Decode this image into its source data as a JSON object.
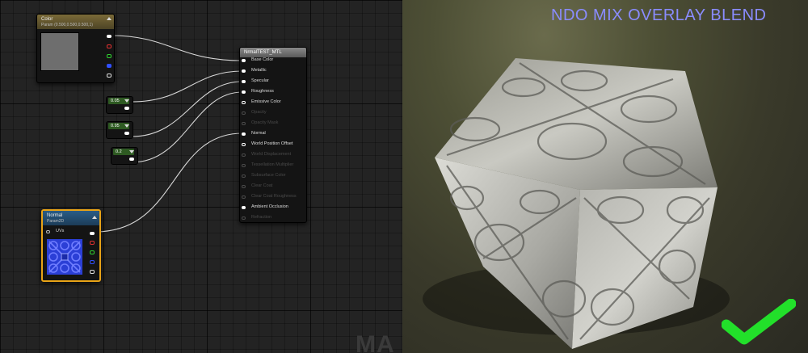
{
  "graph": {
    "color_node": {
      "title": "Color",
      "subtitle": "Param (0.500,0.500,0.500,1)"
    },
    "material_node": {
      "title": "NrmalTEST_MTL",
      "inputs": [
        {
          "label": "Base Color",
          "enabled": true
        },
        {
          "label": "Metallic",
          "enabled": true
        },
        {
          "label": "Specular",
          "enabled": true
        },
        {
          "label": "Roughness",
          "enabled": true
        },
        {
          "label": "Emissive Color",
          "enabled": true
        },
        {
          "label": "Opacity",
          "enabled": false
        },
        {
          "label": "Opacity Mask",
          "enabled": false
        },
        {
          "label": "Normal",
          "enabled": true
        },
        {
          "label": "World Position Offset",
          "enabled": true
        },
        {
          "label": "World Displacement",
          "enabled": false
        },
        {
          "label": "Tessellation Multiplier",
          "enabled": false
        },
        {
          "label": "Subsurface Color",
          "enabled": false
        },
        {
          "label": "Clear Coat",
          "enabled": false
        },
        {
          "label": "Clear Coat Roughness",
          "enabled": false
        },
        {
          "label": "Ambient Occlusion",
          "enabled": true
        },
        {
          "label": "Refraction",
          "enabled": false
        }
      ]
    },
    "constants": [
      {
        "value": "0.05"
      },
      {
        "value": "0.95"
      },
      {
        "value": "0.2"
      }
    ],
    "normal_node": {
      "title": "Normal",
      "subtitle": "Param2D",
      "uv_label": "UVs"
    },
    "watermark": "MA"
  },
  "viewport": {
    "title": "NDO MIX OVERLAY BLEND",
    "title_color": "#8a8cff",
    "check_color": "#22e02a"
  }
}
